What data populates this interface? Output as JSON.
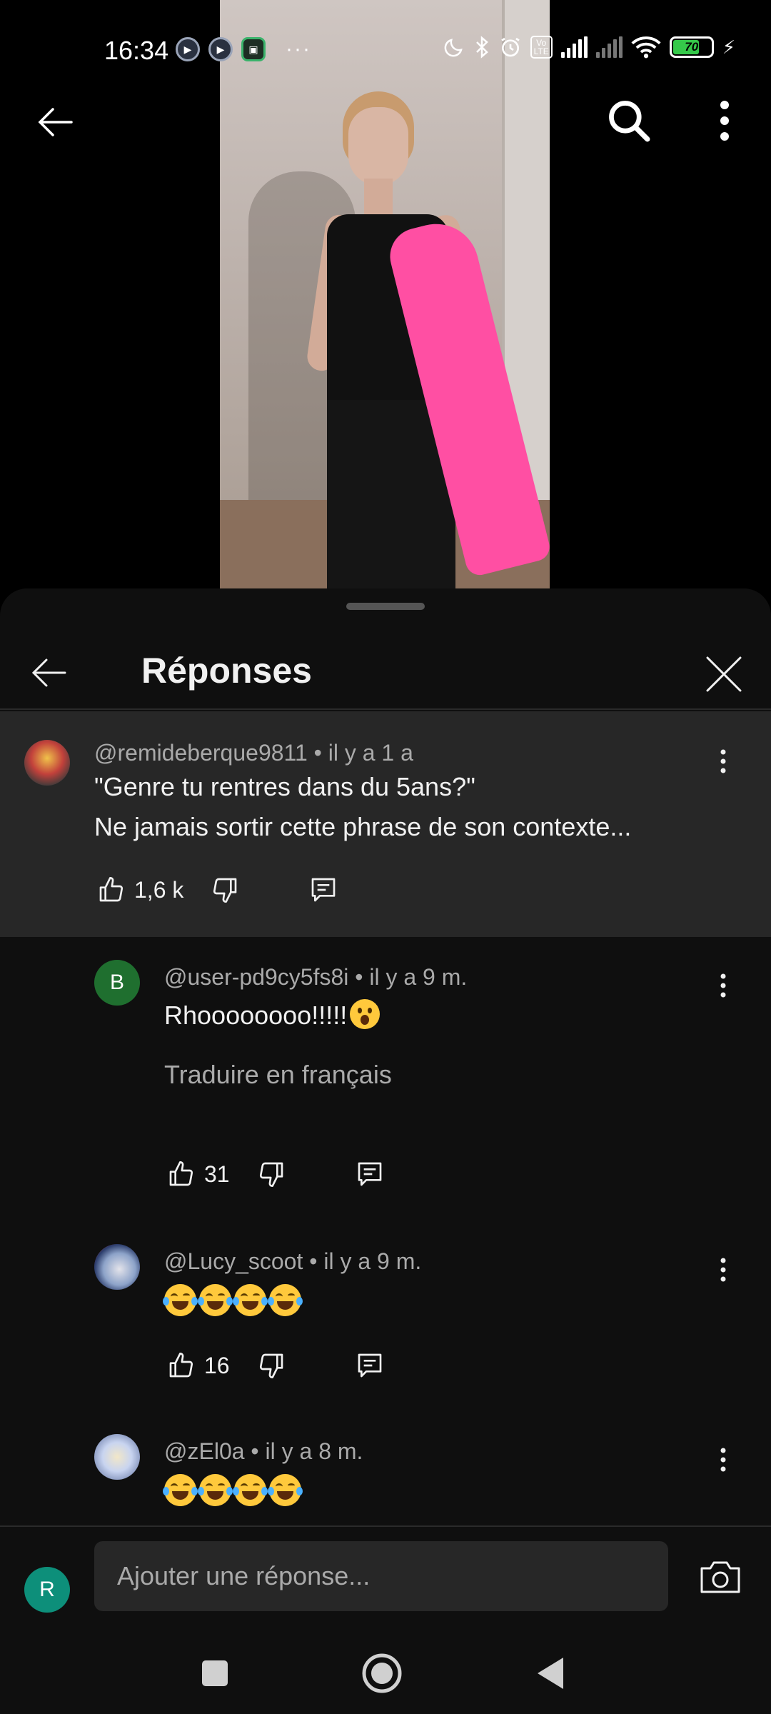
{
  "status_bar": {
    "time": "16:34",
    "app_icons": [
      "play-icon",
      "play-icon",
      "app-icon"
    ],
    "more_indicator": "···",
    "battery_level": "70",
    "icons": [
      "moon-icon",
      "bluetooth-icon",
      "alarm-icon",
      "volte-icon",
      "signal-icon",
      "signal-icon",
      "wifi-icon",
      "battery-icon",
      "charging-icon"
    ],
    "volte_label": "Vo LTE"
  },
  "top_nav": {
    "back_icon": "arrow-left-icon",
    "search_icon": "search-icon",
    "more_icon": "more-vert-icon"
  },
  "sheet": {
    "title": "Réponses",
    "close_icon": "close-icon",
    "back_icon": "arrow-left-icon"
  },
  "parent_comment": {
    "author": "@remideberque9811",
    "time": "il y a 1 a",
    "text_line1": "\"Genre tu rentres dans du 5ans?\"",
    "text_line2": "Ne jamais sortir cette phrase de son contexte...",
    "likes": "1,6 k"
  },
  "replies": [
    {
      "avatar_letter": "B",
      "author": "@user-pd9cy5fs8i",
      "time": "il y a 9 m.",
      "text": "Rhoooooooo!!!!!",
      "translate_label": "Traduire en français",
      "likes": "31"
    },
    {
      "author": "@Lucy_scoot",
      "time": "il y a 9 m.",
      "text": "😂😂😂😂",
      "likes": "16"
    },
    {
      "author": "@zEl0a",
      "time": "il y a 8 m.",
      "text": "😂😂😂😂"
    }
  ],
  "composer": {
    "avatar_letter": "R",
    "placeholder": "Ajouter une réponse...",
    "camera_icon": "camera-icon"
  },
  "android_nav": {
    "icons": [
      "recents-square-icon",
      "home-circle-icon",
      "back-triangle-icon"
    ]
  },
  "colors": {
    "sheet_bg": "#0f0f0f",
    "highlight_bg": "#272727",
    "secondary_text": "#aaaaaa",
    "primary_text": "#f1f1f1"
  }
}
